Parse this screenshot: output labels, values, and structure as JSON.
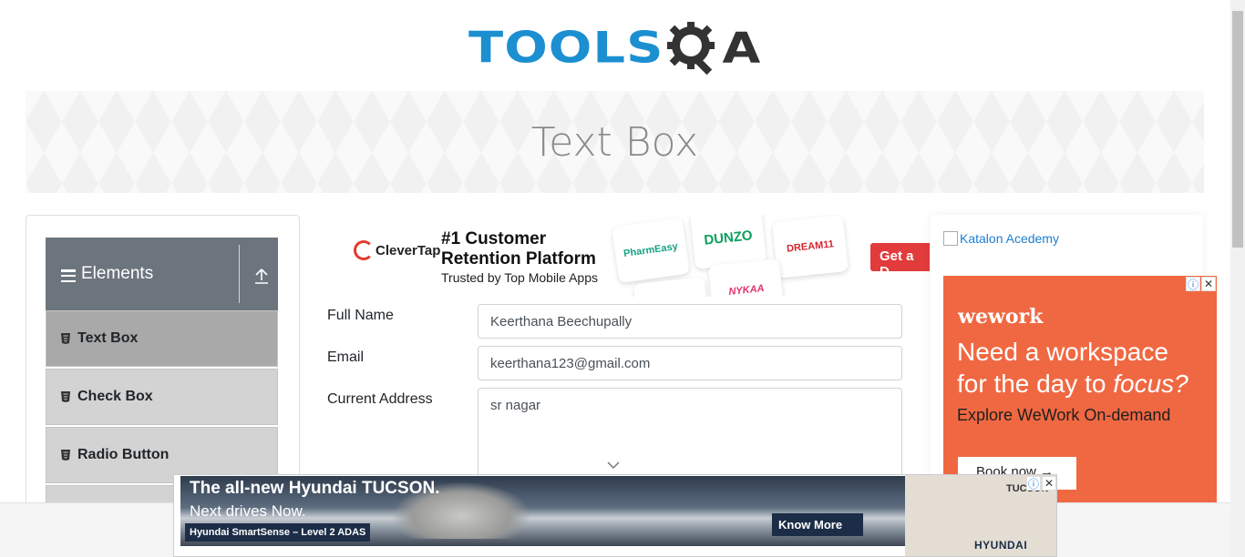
{
  "header": {
    "logo_main": "TOOLS",
    "logo_tail": "A"
  },
  "banner": {
    "title": "Text Box"
  },
  "sidebar": {
    "group_title": "Elements",
    "items": [
      {
        "label": "Text Box",
        "active": true
      },
      {
        "label": "Check Box",
        "active": false
      },
      {
        "label": "Radio Button",
        "active": false
      }
    ]
  },
  "ad_top": {
    "brand": "CleverTap",
    "headline": "#1 Customer Retention Platform",
    "subline": "Trusted by Top Mobile Apps",
    "cards": [
      "PharmEasy",
      "DUNZO",
      "DREAM11",
      "NYKAA"
    ],
    "cta": "Get a D"
  },
  "form": {
    "full_name_label": "Full Name",
    "full_name_value": "Keerthana Beechupally",
    "email_label": "Email",
    "email_value": "keerthana123@gmail.com",
    "address_label": "Current Address",
    "address_value": "sr nagar"
  },
  "right_ads": {
    "katalon_alt": "Katalon Acedemy",
    "wework_brand": "wework",
    "wework_headline_1": "Need a workspace",
    "wework_headline_2": "for the day to ",
    "wework_headline_em": "focus?",
    "wework_sub": "Explore WeWork On-demand",
    "wework_cta": "Book now",
    "info_glyph": "ⓘ",
    "close_glyph": "✕"
  },
  "bottom_ad": {
    "headline": "The all-new Hyundai TUCSON.",
    "subline": "Next drives Now.",
    "tag": "Hyundai SmartSense – Level 2 ADAS",
    "cta": "Know More",
    "model": "TUCSON",
    "brand": "HYUNDAI"
  },
  "colors": {
    "brand_blue": "#1c8fd1",
    "sidebar_header": "#6c757d",
    "active_item": "#a9a9a9",
    "wework_orange": "#f06842"
  }
}
